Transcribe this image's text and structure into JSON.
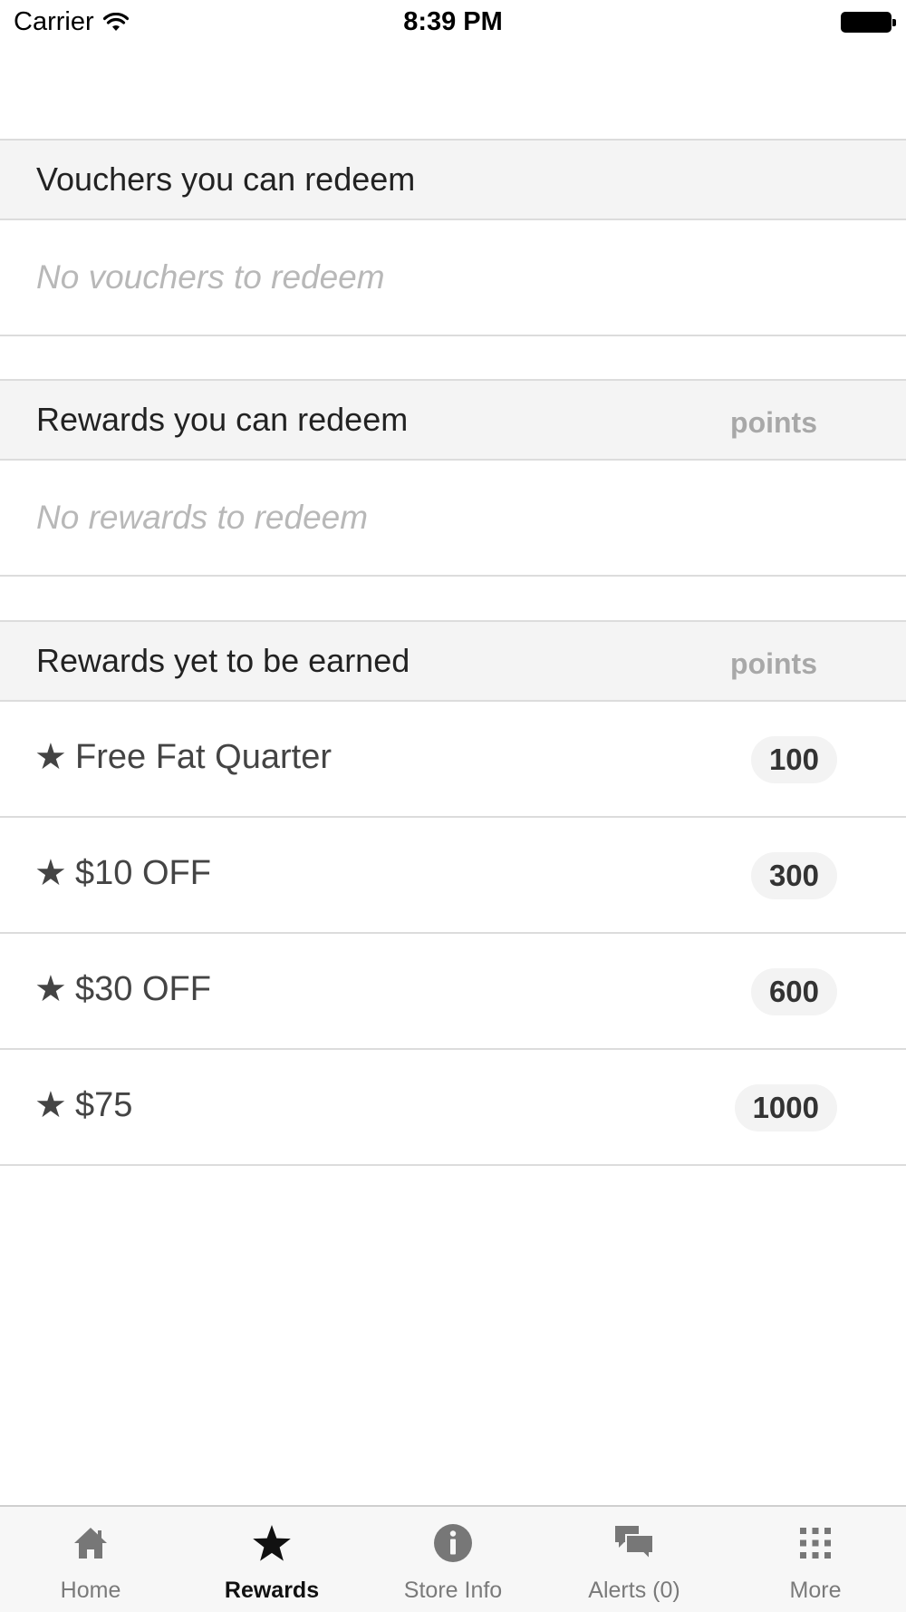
{
  "status_bar": {
    "carrier": "Carrier",
    "time": "8:39 PM"
  },
  "sections": {
    "vouchers": {
      "title": "Vouchers you can redeem",
      "empty_text": "No vouchers to redeem"
    },
    "rewards_redeemable": {
      "title": "Rewards you can redeem",
      "points_label": "points",
      "empty_text": "No rewards to redeem"
    },
    "rewards_unearned": {
      "title": "Rewards yet to be earned",
      "points_label": "points",
      "items": [
        {
          "star": "★",
          "label": "Free Fat Quarter",
          "points": "100"
        },
        {
          "star": "★",
          "label": "$10 OFF",
          "points": "300"
        },
        {
          "star": "★",
          "label": "$30 OFF",
          "points": "600"
        },
        {
          "star": "★",
          "label": "$75",
          "points": "1000"
        }
      ]
    }
  },
  "tab_bar": {
    "active_tab": "Rewards",
    "tabs": [
      {
        "label": "Home",
        "icon": "home-icon"
      },
      {
        "label": "Rewards",
        "icon": "star-icon"
      },
      {
        "label": "Store Info",
        "icon": "info-icon"
      },
      {
        "label": "Alerts (0)",
        "icon": "chat-bubbles-icon"
      },
      {
        "label": "More",
        "icon": "grid-dots-icon"
      }
    ]
  }
}
